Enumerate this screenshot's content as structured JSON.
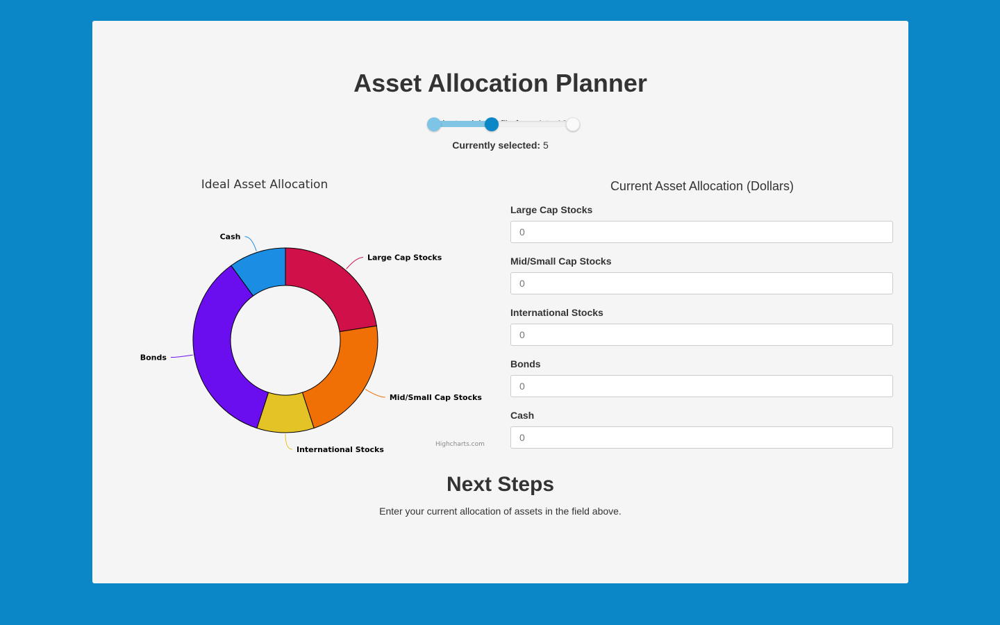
{
  "header": {
    "title": "Asset Allocation Planner"
  },
  "risk": {
    "prompt": "Select a risk profile from 1 to 10:",
    "min": 1,
    "max": 10,
    "value": 5,
    "selected_label": "Currently selected:",
    "selected_value": "5"
  },
  "chart_data": {
    "type": "pie",
    "title": "Ideal Asset Allocation",
    "donut": true,
    "categories": [
      "Large Cap Stocks",
      "Mid/Small Cap Stocks",
      "International Stocks",
      "Bonds",
      "Cash"
    ],
    "values": [
      22.5,
      22.5,
      10,
      35,
      10
    ],
    "colors": [
      "#d01048",
      "#f07005",
      "#e4c326",
      "#6a0ef0",
      "#1b8ee4"
    ],
    "credit": "Highcharts.com"
  },
  "form": {
    "title": "Current Asset Allocation (Dollars)",
    "fields": [
      {
        "label": "Large Cap Stocks",
        "value": "",
        "placeholder": "0"
      },
      {
        "label": "Mid/Small Cap Stocks",
        "value": "",
        "placeholder": "0"
      },
      {
        "label": "International Stocks",
        "value": "",
        "placeholder": "0"
      },
      {
        "label": "Bonds",
        "value": "",
        "placeholder": "0"
      },
      {
        "label": "Cash",
        "value": "",
        "placeholder": "0"
      }
    ]
  },
  "next_steps": {
    "title": "Next Steps",
    "text": "Enter your current allocation of assets in the field above."
  }
}
